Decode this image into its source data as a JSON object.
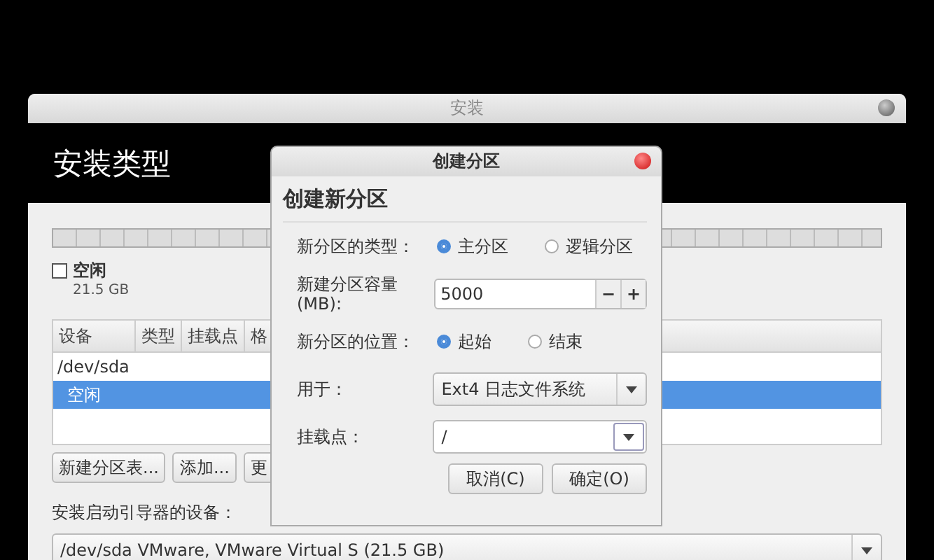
{
  "window": {
    "title": "安装",
    "header": "安装类型"
  },
  "free_space": {
    "checked": false,
    "label": "空闲",
    "size": "21.5 GB"
  },
  "table": {
    "columns": [
      "设备",
      "类型",
      "挂载点",
      "格"
    ],
    "rows": [
      {
        "device": "/dev/sda",
        "selected": false,
        "children": [
          {
            "device": "空闲",
            "selected": true
          }
        ]
      }
    ]
  },
  "table_buttons": [
    "新建分区表...",
    "添加...",
    "更"
  ],
  "bootloader": {
    "label": "安装启动引导器的设备：",
    "value": "/dev/sda VMware, VMware Virtual S (21.5 GB)"
  },
  "dialog": {
    "title": "创建分区",
    "heading": "创建新分区",
    "type": {
      "label": "新分区的类型：",
      "options": [
        {
          "label": "主分区",
          "selected": true
        },
        {
          "label": "逻辑分区",
          "selected": false
        }
      ]
    },
    "size": {
      "label": "新建分区容量\n(MB):",
      "value": "5000",
      "minus": "−",
      "plus": "+"
    },
    "location": {
      "label": "新分区的位置：",
      "options": [
        {
          "label": "起始",
          "selected": true
        },
        {
          "label": "结束",
          "selected": false
        }
      ]
    },
    "use_as": {
      "label": "用于：",
      "value": "Ext4 日志文件系统"
    },
    "mount_point": {
      "label": "挂载点：",
      "value": "/"
    },
    "buttons": [
      "取消(C)",
      "确定(O)"
    ]
  }
}
